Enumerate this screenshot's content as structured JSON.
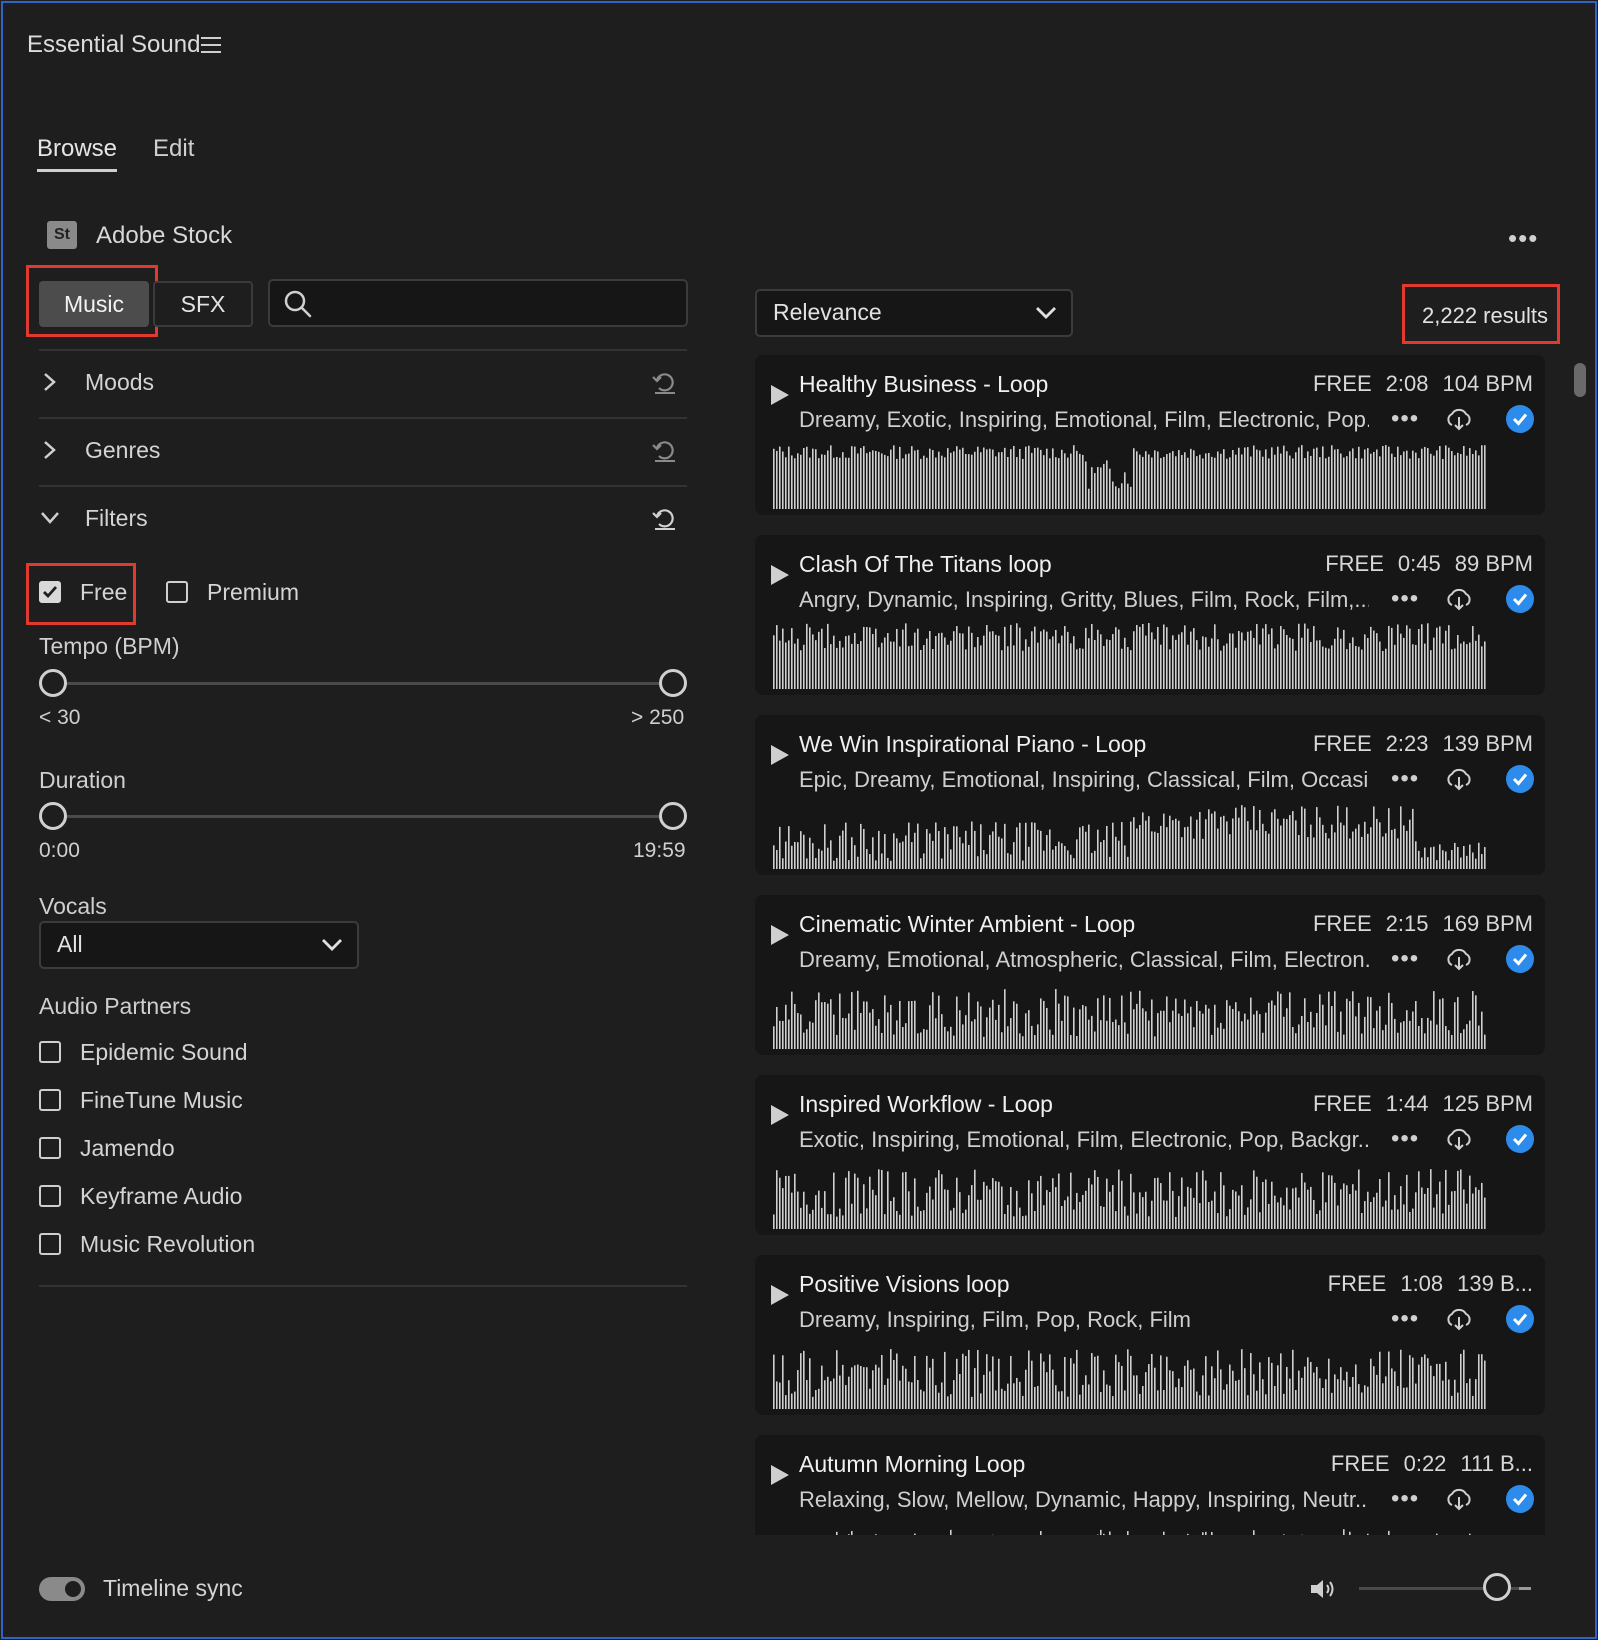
{
  "panel": {
    "title": "Essential Sound"
  },
  "tabs": [
    {
      "label": "Browse"
    },
    {
      "label": "Edit"
    }
  ],
  "source": {
    "logo_text": "St",
    "label": "Adobe Stock",
    "more": "•••"
  },
  "type_toggle": {
    "music": "Music",
    "sfx": "SFX"
  },
  "search": {
    "placeholder": ""
  },
  "sections": {
    "moods": "Moods",
    "genres": "Genres",
    "filters": "Filters"
  },
  "filters": {
    "free": {
      "label": "Free",
      "checked": true
    },
    "premium": {
      "label": "Premium",
      "checked": false
    },
    "tempo": {
      "label": "Tempo (BPM)",
      "min": "< 30",
      "max": "> 250"
    },
    "duration": {
      "label": "Duration",
      "min": "0:00",
      "max": "19:59"
    },
    "vocals": {
      "label": "Vocals",
      "value": "All"
    },
    "partners": {
      "label": "Audio Partners",
      "items": [
        "Epidemic Sound",
        "FineTune Music",
        "Jamendo",
        "Keyframe Audio",
        "Music Revolution"
      ]
    }
  },
  "sort": {
    "value": "Relevance"
  },
  "results": {
    "count": "2,222 results"
  },
  "tracks": [
    {
      "title": "Healthy Business - Loop",
      "price": "FREE",
      "duration": "2:08",
      "bpm": "104 BPM",
      "tags": "Dreamy, Exotic, Inspiring, Emotional, Film, Electronic, Pop..."
    },
    {
      "title": "Clash Of The Titans loop",
      "price": "FREE",
      "duration": "0:45",
      "bpm": "89 BPM",
      "tags": "Angry, Dynamic, Inspiring, Gritty, Blues, Film, Rock, Film,..."
    },
    {
      "title": "We Win Inspirational Piano - Loop",
      "price": "FREE",
      "duration": "2:23",
      "bpm": "139 BPM",
      "tags": "Epic, Dreamy, Emotional, Inspiring, Classical, Film, Occasi..."
    },
    {
      "title": "Cinematic Winter Ambient - Loop",
      "price": "FREE",
      "duration": "2:15",
      "bpm": "169 BPM",
      "tags": "Dreamy, Emotional, Atmospheric, Classical, Film, Electron..."
    },
    {
      "title": "Inspired Workflow - Loop",
      "price": "FREE",
      "duration": "1:44",
      "bpm": "125 BPM",
      "tags": "Exotic, Inspiring, Emotional, Film, Electronic, Pop, Backgr..."
    },
    {
      "title": "Positive Visions loop",
      "price": "FREE",
      "duration": "1:08",
      "bpm": "139 B...",
      "tags": "Dreamy, Inspiring, Film, Pop, Rock, Film"
    },
    {
      "title": "Autumn Morning Loop",
      "price": "FREE",
      "duration": "0:22",
      "bpm": "111 B...",
      "tags": "Relaxing, Slow, Mellow, Dynamic, Happy, Inspiring, Neutr..."
    }
  ],
  "footer": {
    "timeline_sync": "Timeline sync",
    "timeline_sync_on": true
  },
  "colors": {
    "accent": "#2d8ceb",
    "highlight": "#e03a2f",
    "background": "#1e1e1e",
    "card": "#161616"
  }
}
